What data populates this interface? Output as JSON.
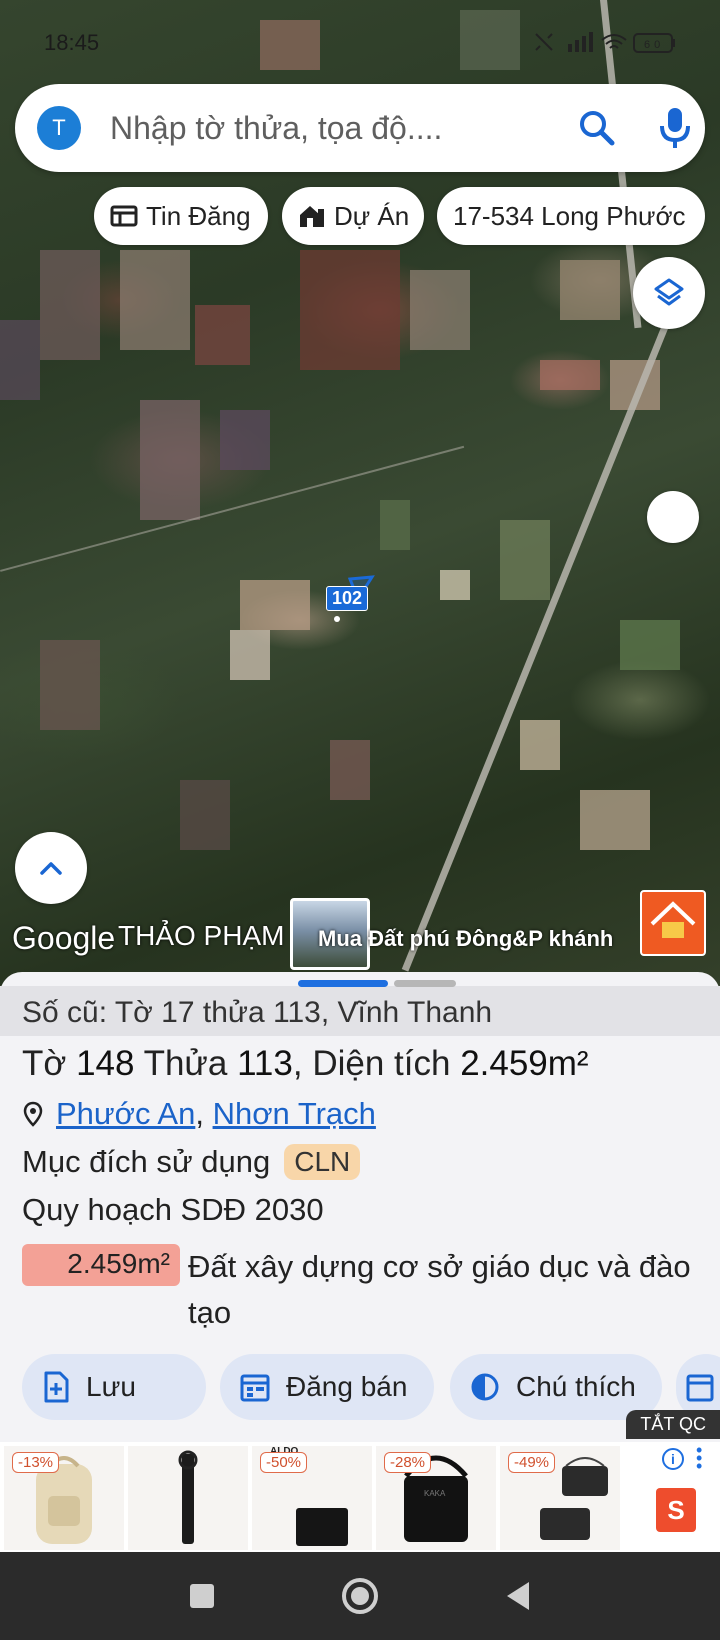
{
  "status": {
    "time": "18:45",
    "battery": "60"
  },
  "search": {
    "avatar_letter": "T",
    "placeholder": "Nhập tờ thửa, tọa độ...."
  },
  "chips": [
    {
      "label": "Tin Đăng",
      "icon": "listing-icon"
    },
    {
      "label": "Dự Án",
      "icon": "project-icon"
    },
    {
      "label": "17-534 Long Phước",
      "icon": ""
    }
  ],
  "map": {
    "parcel_label": "102",
    "google_logo": "Google",
    "owner": "THẢO PHẠM",
    "ad_banner": "Mua Đất phú Đông&P khánh"
  },
  "sheet": {
    "old_info": "Số cũ: Tờ 17 thửa 113, Vĩnh Thanh",
    "to_label": "Tờ",
    "to_value": "148",
    "thua_label": "Thửa",
    "thua_value": "113",
    "area_label": ", Diện tích",
    "area_value": "2.459m²",
    "ward": "Phước An",
    "district": "Nhơn Trạch",
    "purpose_label": "Mục đích sử dụng",
    "purpose_code": "CLN",
    "plan_label": "Quy hoạch SDĐ 2030",
    "plan_area": "2.459m²",
    "plan_desc": "Đất xây dựng cơ sở giáo dục và đào tạo"
  },
  "actions": [
    {
      "label": "Lưu",
      "icon": "add-file-icon"
    },
    {
      "label": "Đăng bán",
      "icon": "calendar-icon"
    },
    {
      "label": "Chú thích",
      "icon": "contrast-icon"
    }
  ],
  "ad": {
    "close_label": "TẮT QC",
    "items": [
      {
        "discount": "-13%",
        "product": "backpack"
      },
      {
        "discount": "",
        "product": "strap"
      },
      {
        "discount": "-50%",
        "product": "wallet",
        "brand": "ALDO"
      },
      {
        "discount": "-28%",
        "product": "shoulder-bag"
      },
      {
        "discount": "-49%",
        "product": "crossbody-bag"
      }
    ],
    "shop_letter": "S"
  },
  "colors": {
    "accent": "#1e6fe0",
    "badge": "#f8d6a9",
    "plan_area": "#f3a196",
    "chip_bg": "#ffffff"
  }
}
